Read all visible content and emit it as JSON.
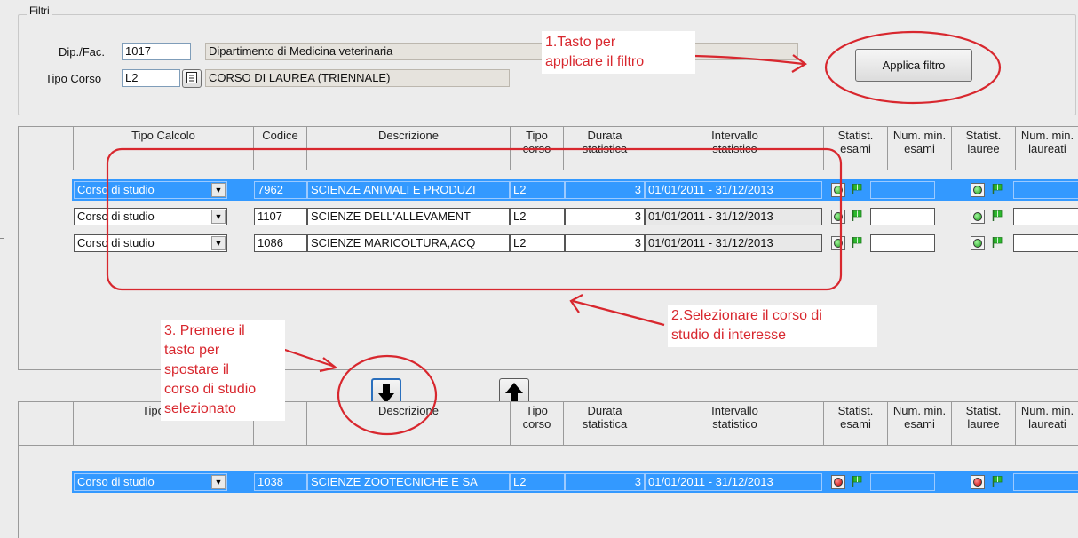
{
  "filtri": {
    "title": "Filtri",
    "dip_label": "Dip./Fac.",
    "dip_code": "1017",
    "dip_desc": "Dipartimento di Medicina veterinaria",
    "tipo_label": "Tipo Corso",
    "tipo_code": "L2",
    "tipo_desc": "CORSO DI LAUREA (TRIENNALE)",
    "apply_button": "Applica filtro"
  },
  "annotations": {
    "a1": "1.Tasto per\napplicare il filtro",
    "a2": "2.Selezionare il corso di\nstudio di interesse",
    "a3": "3. Premere il\ntasto per\nspostare il\ncorso di studio\nselezionato"
  },
  "columns": {
    "tipo_calcolo": "Tipo Calcolo",
    "codice": "Codice",
    "descrizione": "Descrizione",
    "tipo_corso": "Tipo\ncorso",
    "durata": "Durata\nstatistica",
    "intervallo": "Intervallo\nstatistico",
    "stat_esami": "Statist.\nesami",
    "num_esami": "Num. min.\nesami",
    "stat_lauree": "Statist.\nlauree",
    "num_laureati": "Num. min.\nlaureati"
  },
  "columns_lower": {
    "tipo_calcolo": "Tipo Cal",
    "codice": "e"
  },
  "upper_rows": [
    {
      "tipo": "Corso di studio",
      "codice": "7962",
      "descrizione": "SCIENZE ANIMALI E PRODUZI",
      "tipo_corso": "L2",
      "durata": "3",
      "intervallo": "01/01/2011 - 31/12/2013",
      "esami_status": "green",
      "lauree_status": "green",
      "selected": true
    },
    {
      "tipo": "Corso di studio",
      "codice": "1107",
      "descrizione": "SCIENZE DELL'ALLEVAMENT",
      "tipo_corso": "L2",
      "durata": "3",
      "intervallo": "01/01/2011 - 31/12/2013",
      "esami_status": "green",
      "lauree_status": "green",
      "selected": false
    },
    {
      "tipo": "Corso di studio",
      "codice": "1086",
      "descrizione": "SCIENZE MARICOLTURA,ACQ",
      "tipo_corso": "L2",
      "durata": "3",
      "intervallo": "01/01/2011 - 31/12/2013",
      "esami_status": "green",
      "lauree_status": "green",
      "selected": false
    }
  ],
  "lower_rows": [
    {
      "tipo": "Corso di studio",
      "codice": "1038",
      "descrizione": "SCIENZE ZOOTECNICHE E SA",
      "tipo_corso": "L2",
      "durata": "3",
      "intervallo": "01/01/2011 - 31/12/2013",
      "esami_status": "red",
      "lauree_status": "red",
      "selected": true
    }
  ],
  "move_buttons": {
    "down_icon": "arrow-down-icon",
    "up_icon": "arrow-up-icon"
  },
  "colors": {
    "selection": "#3399ff",
    "annotation": "#d8272e",
    "flag_green": "#2db82d"
  }
}
